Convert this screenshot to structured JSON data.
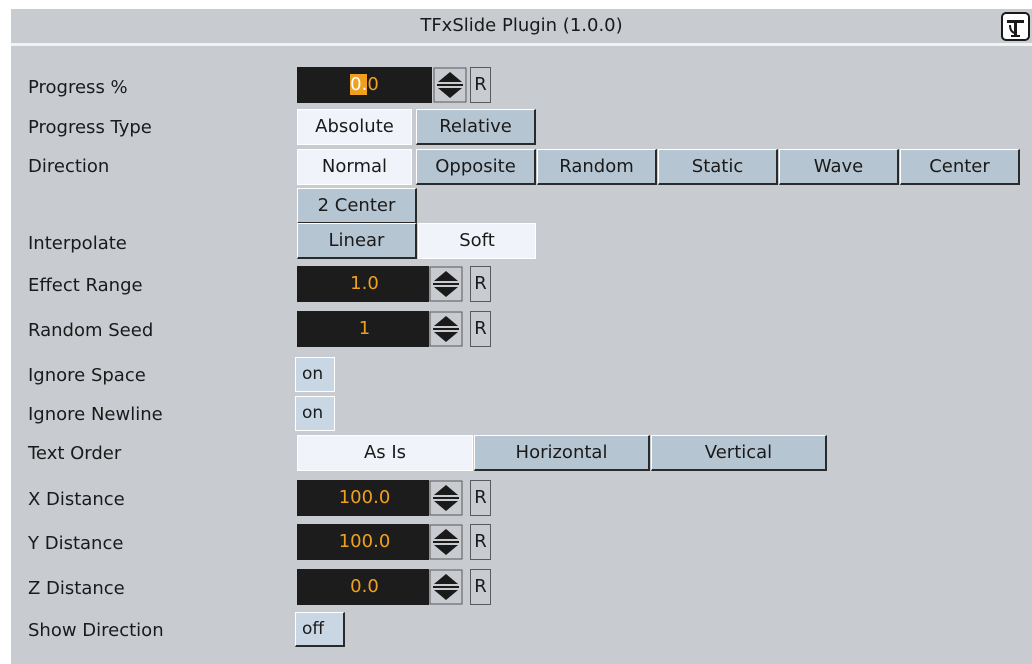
{
  "window": {
    "title": "TFxSlide Plugin (1.0.0)",
    "help_icon": "help-icon"
  },
  "labels": {
    "progress": "Progress %",
    "progress_type": "Progress Type",
    "direction": "Direction",
    "interpolate": "Interpolate",
    "effect_range": "Effect Range",
    "random_seed": "Random Seed",
    "ignore_space": "Ignore Space",
    "ignore_newline": "Ignore Newline",
    "text_order": "Text Order",
    "x_distance": "X Distance",
    "y_distance": "Y Distance",
    "z_distance": "Z Distance",
    "show_direction": "Show Direction"
  },
  "values": {
    "progress_highlight": "0.",
    "progress_rest": "0",
    "effect_range": "1.0",
    "random_seed": "1",
    "x_distance": "100.0",
    "y_distance": "100.0",
    "z_distance": "0.0"
  },
  "reset_label": "R",
  "progress_type": {
    "options": [
      "Absolute",
      "Relative"
    ],
    "selected": "Absolute"
  },
  "direction": {
    "options": [
      "Normal",
      "Opposite",
      "Random",
      "Static",
      "Wave",
      "Center",
      "2 Center"
    ],
    "selected": "Normal"
  },
  "interpolate": {
    "options": [
      "Linear",
      "Soft"
    ],
    "selected": "Soft"
  },
  "text_order": {
    "options": [
      "As Is",
      "Horizontal",
      "Vertical"
    ],
    "selected": "As Is"
  },
  "toggles": {
    "ignore_space": "on",
    "ignore_newline": "on",
    "show_direction": "off"
  },
  "colors": {
    "panel_bg": "#c8cbd0",
    "field_bg": "#1c1c1c",
    "field_text": "#f0a020",
    "tab_selected": "#f0f4fa",
    "tab_unselected": "#b6c5d2"
  }
}
